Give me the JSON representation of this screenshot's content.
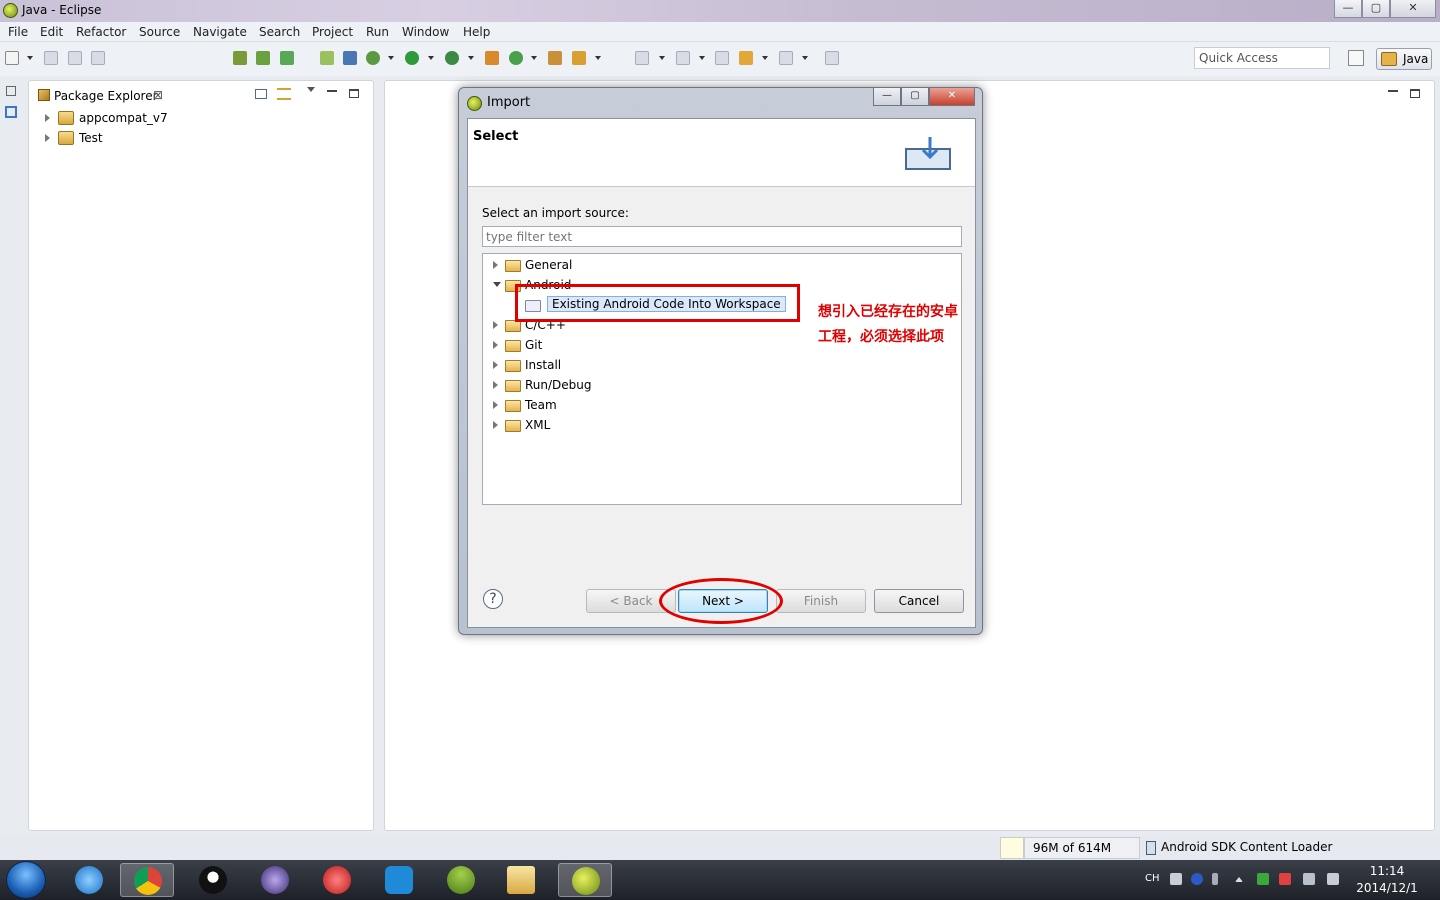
{
  "window": {
    "title": "Java - Eclipse",
    "minimize": "—",
    "maximize": "▢",
    "close": "✕"
  },
  "menu": [
    "File",
    "Edit",
    "Refactor",
    "Source",
    "Navigate",
    "Search",
    "Project",
    "Run",
    "Window",
    "Help"
  ],
  "toolbar": {
    "quick_access": "Quick Access",
    "perspective": "Java"
  },
  "package_explorer": {
    "tab_label": "Package Explorer",
    "close": "⊠",
    "projects": [
      {
        "label": "appcompat_v7"
      },
      {
        "label": "Test"
      }
    ]
  },
  "status": {
    "heap": "96M of 614M",
    "task": "Android SDK Content Loader"
  },
  "taskbar": {
    "lang": "CH",
    "time": "11:14",
    "date": "2014/12/1"
  },
  "dialog": {
    "title": "Import",
    "header": "Select",
    "source_label": "Select an import source:",
    "filter_placeholder": "type filter text",
    "tree": [
      {
        "label": "General",
        "expanded": false
      },
      {
        "label": "Android",
        "expanded": true
      },
      {
        "label": "Existing Android Code Into Workspace",
        "selected": true
      },
      {
        "label": "C/C++",
        "expanded": false
      },
      {
        "label": "Git",
        "expanded": false
      },
      {
        "label": "Install",
        "expanded": false
      },
      {
        "label": "Run/Debug",
        "expanded": false
      },
      {
        "label": "Team",
        "expanded": false
      },
      {
        "label": "XML",
        "expanded": false
      }
    ],
    "buttons": {
      "help": "?",
      "back": "< Back",
      "next": "Next >",
      "finish": "Finish",
      "cancel": "Cancel"
    }
  },
  "annotation": {
    "text": "想引入已经存在的安卓工程，必须选择此项",
    "color": "#e00000"
  }
}
